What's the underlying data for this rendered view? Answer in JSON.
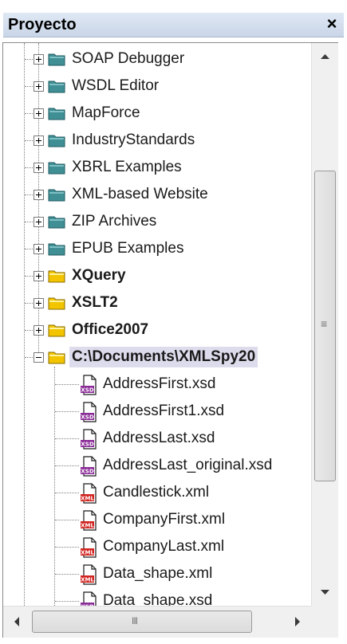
{
  "panel": {
    "title": "Proyecto",
    "close_label": "×"
  },
  "tree": {
    "folders": [
      {
        "label": "SOAP Debugger",
        "kind": "teal",
        "bold": false
      },
      {
        "label": "WSDL Editor",
        "kind": "teal",
        "bold": false
      },
      {
        "label": "MapForce",
        "kind": "teal",
        "bold": false
      },
      {
        "label": "IndustryStandards",
        "kind": "teal",
        "bold": false
      },
      {
        "label": "XBRL Examples",
        "kind": "teal",
        "bold": false
      },
      {
        "label": "XML-based Website",
        "kind": "teal",
        "bold": false
      },
      {
        "label": "ZIP Archives",
        "kind": "teal",
        "bold": false
      },
      {
        "label": "EPUB Examples",
        "kind": "teal",
        "bold": false
      },
      {
        "label": "XQuery",
        "kind": "yellow",
        "bold": true
      },
      {
        "label": "XSLT2",
        "kind": "yellow",
        "bold": true
      },
      {
        "label": "Office2007",
        "kind": "yellow",
        "bold": true
      },
      {
        "label": "C:\\Documents\\XMLSpy20",
        "kind": "yellow",
        "bold": true,
        "expanded": true,
        "selected": true
      }
    ],
    "files": [
      {
        "label": "AddressFirst.xsd",
        "type": "XSD"
      },
      {
        "label": "AddressFirst1.xsd",
        "type": "XSD"
      },
      {
        "label": "AddressLast.xsd",
        "type": "XSD"
      },
      {
        "label": "AddressLast_original.xsd",
        "type": "XSD"
      },
      {
        "label": "Candlestick.xml",
        "type": "XML"
      },
      {
        "label": "CompanyFirst.xml",
        "type": "XML"
      },
      {
        "label": "CompanyLast.xml",
        "type": "XML"
      },
      {
        "label": "Data_shape.xml",
        "type": "XML"
      },
      {
        "label": "Data_shape.xsd",
        "type": "XSD"
      }
    ]
  },
  "colors": {
    "teal_folder": "#3f8f95",
    "yellow_folder": "#f2c500",
    "xsd_badge": "#8a2b98",
    "xml_badge": "#d2231f",
    "selection": "#dcdcec"
  },
  "scrollbars": {
    "vertical_grip": "≡",
    "horizontal_grip": "III"
  }
}
